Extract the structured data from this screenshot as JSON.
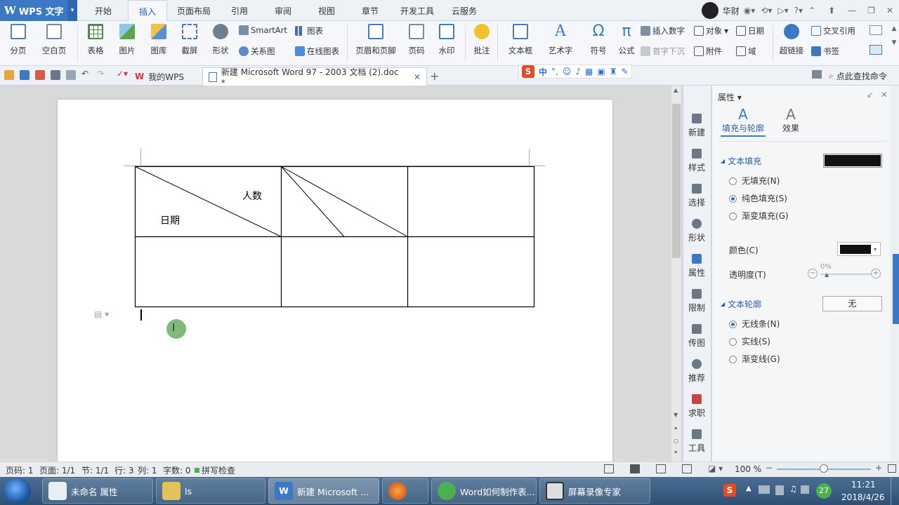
{
  "app": {
    "name": "WPS 文字"
  },
  "menu_tabs": [
    "开始",
    "插入",
    "页面布局",
    "引用",
    "审阅",
    "视图",
    "章节",
    "开发工具",
    "云服务"
  ],
  "active_tab": "插入",
  "user": {
    "name": "华财"
  },
  "ribbon": {
    "page_break": "分页",
    "blank_page": "空白页",
    "table": "表格",
    "picture": "图片",
    "gallery": "图库",
    "screenshot": "截屏",
    "shape": "形状",
    "smartart": "SmartArt",
    "chart": "图表",
    "relation": "关系图",
    "online_chart": "在线图表",
    "header_footer": "页眉和页脚",
    "page_number": "页码",
    "watermark": "水印",
    "comment": "批注",
    "textbox": "文本框",
    "wordart": "艺术字",
    "symbol": "符号",
    "formula": "公式",
    "insert_number": "插入数字",
    "dropcap": "首字下沉",
    "object": "对象",
    "attachment": "附件",
    "date": "日期",
    "field": "域",
    "hyperlink": "超链接",
    "cross_ref": "交叉引用",
    "bookmark": "书签"
  },
  "tabs": {
    "my_wps": "我的WPS",
    "document": "新建 Microsoft Word 97 - 2003 文档 (2).doc *",
    "search": "点此查找命令"
  },
  "ime": {
    "label": "中"
  },
  "document": {
    "cell_person": "人数",
    "cell_date": "日期"
  },
  "side_tools": [
    "新建",
    "样式",
    "选择",
    "形状",
    "属性",
    "限制",
    "传图",
    "推荐",
    "求职",
    "工具"
  ],
  "panel": {
    "title": "属性",
    "tab_fill": "填充与轮廓",
    "tab_effect": "效果",
    "text_fill": "文本填充",
    "no_fill": "无填充(N)",
    "solid_fill": "纯色填充(S)",
    "gradient_fill": "渐变填充(G)",
    "color_label": "颜色(C)",
    "transparency_label": "透明度(T)",
    "transparency_value": "0%",
    "text_outline": "文本轮廓",
    "outline_value": "无",
    "no_line": "无线条(N)",
    "solid_line": "实线(S)",
    "gradient_line": "渐变线(G)",
    "fill_color": "#111111"
  },
  "status": {
    "page": "页码: 1",
    "pages": "页面: 1/1",
    "section": "节: 1/1",
    "row": "行: 3",
    "col": "列: 1",
    "words": "字数: 0",
    "spell": "拼写检查",
    "zoom": "100 %"
  },
  "taskbar": {
    "items": [
      "未命名 属性",
      "ls",
      "新建 Microsoft ...",
      "",
      "Word如何制作表...",
      "屏幕录像专家"
    ],
    "tray_num": "27",
    "time": "11:21",
    "date": "2018/4/26"
  }
}
